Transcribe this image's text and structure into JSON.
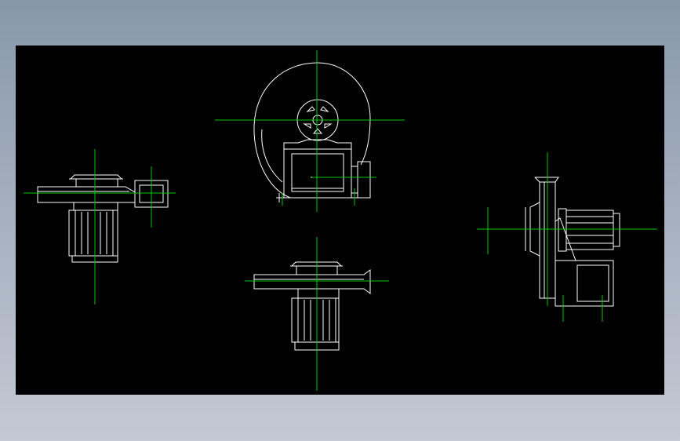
{
  "drawing": {
    "background": "#000000",
    "line_color": "#ffffff",
    "centerline_color": "#00c800"
  },
  "views": [
    {
      "name": "side-view-left"
    },
    {
      "name": "front-view-top"
    },
    {
      "name": "top-view-bottom"
    },
    {
      "name": "side-view-right"
    }
  ]
}
